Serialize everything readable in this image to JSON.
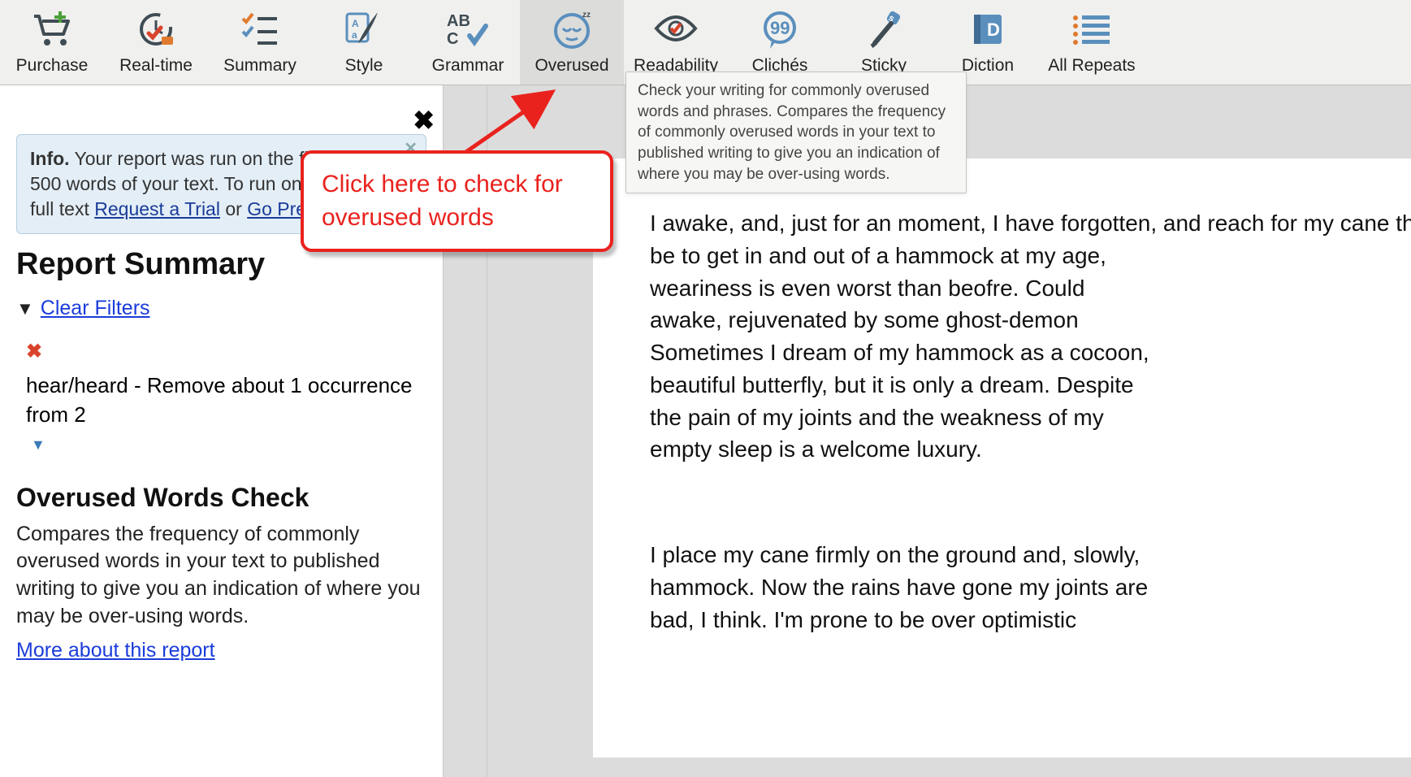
{
  "toolbar": [
    {
      "id": "purchase",
      "label": "Purchase"
    },
    {
      "id": "realtime",
      "label": "Real-time"
    },
    {
      "id": "summary",
      "label": "Summary"
    },
    {
      "id": "style",
      "label": "Style"
    },
    {
      "id": "grammar",
      "label": "Grammar"
    },
    {
      "id": "overused",
      "label": "Overused",
      "active": true
    },
    {
      "id": "readability",
      "label": "Readability"
    },
    {
      "id": "cliches",
      "label": "Clichés"
    },
    {
      "id": "sticky",
      "label": "Sticky"
    },
    {
      "id": "diction",
      "label": "Diction"
    },
    {
      "id": "allrepeats",
      "label": "All Repeats"
    }
  ],
  "tooltip": "Check your writing for commonly overused words and phrases. Compares the frequency of commonly overused words in your text to published writing to give you an indication of where you may be over-using words.",
  "callout": "Click here to check for overused words",
  "sidebar": {
    "info_prefix": "Info.",
    "info_text_1": " Your report was run on the first",
    "info_text_2": "500 words of your text. To run on the",
    "info_text_3": "full text ",
    "info_link_1": "Request a Trial",
    "info_or": " or ",
    "info_link_2": "Go Premium",
    "title": "Report Summary",
    "clear_filters": "Clear Filters",
    "filter_text": "hear/heard - Remove about 1 occurrence from 2",
    "section_title": "Overused Words Check",
    "section_desc": "Compares the frequency of commonly overused words in your text to published writing to give you an indication of where you may be over-using words.",
    "more_link": "More about this report"
  },
  "document": {
    "p1": "I awake, and, just for an moment, I have forgotten, and reach for my cane that always hangs at be to get in and out of a hammock at my age, weariness is even worst than beofre. Could awake, rejuvenated by some ghost-demon Sometimes I dream of my hammock as a cocoon, beautiful butterfly, but it is only a dream. Despite the pain of my joints and the weakness of my empty sleep is a welcome luxury.",
    "p2": "I place my cane firmly on the ground and, slowly, hammock. Now the rains have gone my joints are bad, I think. I'm prone to be over optimistic"
  }
}
